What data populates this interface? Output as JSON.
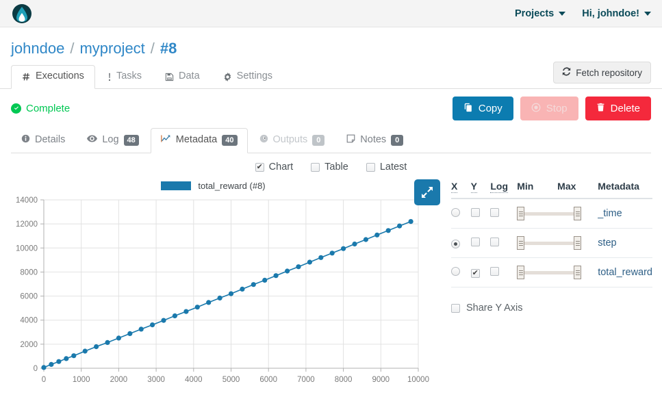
{
  "navbar": {
    "logo_name": "app-logo",
    "projects_label": "Projects",
    "user_label": "Hi, johndoe!"
  },
  "breadcrumb": {
    "user": "johndoe",
    "separator": "/",
    "project": "myproject",
    "current": "#8"
  },
  "main_tabs": [
    {
      "label": "Executions",
      "icon": "hash-icon",
      "icon_glyph": "#",
      "active": true
    },
    {
      "label": "Tasks",
      "icon": "exclamation-icon",
      "icon_glyph": "!",
      "active": false
    },
    {
      "label": "Data",
      "icon": "floppy-disk-icon",
      "icon_glyph": "💾",
      "active": false
    },
    {
      "label": "Settings",
      "icon": "gear-icon",
      "icon_glyph": "⚙",
      "active": false
    }
  ],
  "fetch_button": {
    "label": "Fetch repository",
    "icon": "refresh-icon"
  },
  "status": {
    "label": "Complete",
    "color": "#00c853",
    "icon": "check-circle-icon"
  },
  "actions": [
    {
      "label": "Copy",
      "icon": "copy-icon",
      "color": "#0c7cb0",
      "disabled": false
    },
    {
      "label": "Stop",
      "icon": "stop-circle-icon",
      "color": "#f9b4b4",
      "disabled": true
    },
    {
      "label": "Delete",
      "icon": "trash-icon",
      "color": "#f4293c",
      "disabled": false
    }
  ],
  "sub_tabs": [
    {
      "label": "Details",
      "icon": "info-icon",
      "badge": null,
      "active": false,
      "disabled": false
    },
    {
      "label": "Log",
      "icon": "eye-icon",
      "badge": "48",
      "active": false,
      "disabled": false
    },
    {
      "label": "Metadata",
      "icon": "chart-line-icon",
      "badge": "40",
      "active": true,
      "disabled": false
    },
    {
      "label": "Outputs",
      "icon": "clock-icon",
      "badge": "0",
      "active": false,
      "disabled": true
    },
    {
      "label": "Notes",
      "icon": "note-icon",
      "badge": "0",
      "active": false,
      "disabled": false
    }
  ],
  "view_options": [
    {
      "label": "Chart",
      "checked": true
    },
    {
      "label": "Table",
      "checked": false
    },
    {
      "label": "Latest",
      "checked": false
    }
  ],
  "chart_panel": {
    "legend_label": "total_reward (#8)",
    "series_color": "#1a79ac",
    "expand_button_label": "expand-chart"
  },
  "metadata_table": {
    "headers": [
      "X",
      "Y",
      "Log",
      "Min",
      "Max",
      "Metadata"
    ],
    "rows": [
      {
        "name": "_time",
        "x_selected": false,
        "y_checked": false,
        "log_checked": false
      },
      {
        "name": "step",
        "x_selected": true,
        "y_checked": false,
        "log_checked": false
      },
      {
        "name": "total_reward",
        "x_selected": false,
        "y_checked": true,
        "log_checked": false
      }
    ],
    "share_y_axis": {
      "label": "Share Y Axis",
      "checked": false
    }
  },
  "chart_data": {
    "type": "line",
    "title": "",
    "subtitle": "",
    "xlabel": "",
    "ylabel": "",
    "xlim": [
      0,
      10000
    ],
    "ylim": [
      0,
      14000
    ],
    "xticks": [
      0,
      1000,
      2000,
      3000,
      4000,
      5000,
      6000,
      7000,
      8000,
      9000,
      10000
    ],
    "yticks": [
      0,
      2000,
      4000,
      6000,
      8000,
      10000,
      12000,
      14000
    ],
    "grid": true,
    "legend_position": "top-center",
    "series": [
      {
        "name": "total_reward (#8)",
        "color": "#1a79ac",
        "marker": "circle",
        "x": [
          0,
          200,
          400,
          600,
          800,
          1100,
          1400,
          1700,
          2000,
          2300,
          2600,
          2900,
          3200,
          3500,
          3800,
          4100,
          4400,
          4700,
          5000,
          5300,
          5600,
          5900,
          6200,
          6500,
          6800,
          7100,
          7400,
          7700,
          8000,
          8300,
          8600,
          8900,
          9200,
          9500,
          9800
        ],
        "y": [
          60,
          320,
          560,
          800,
          1040,
          1420,
          1790,
          2140,
          2510,
          2880,
          3250,
          3610,
          3980,
          4360,
          4720,
          5080,
          5470,
          5840,
          6200,
          6580,
          6960,
          7320,
          7700,
          8080,
          8440,
          8820,
          9200,
          9570,
          9950,
          10330,
          10700,
          11080,
          11450,
          11830,
          12200
        ]
      }
    ]
  }
}
